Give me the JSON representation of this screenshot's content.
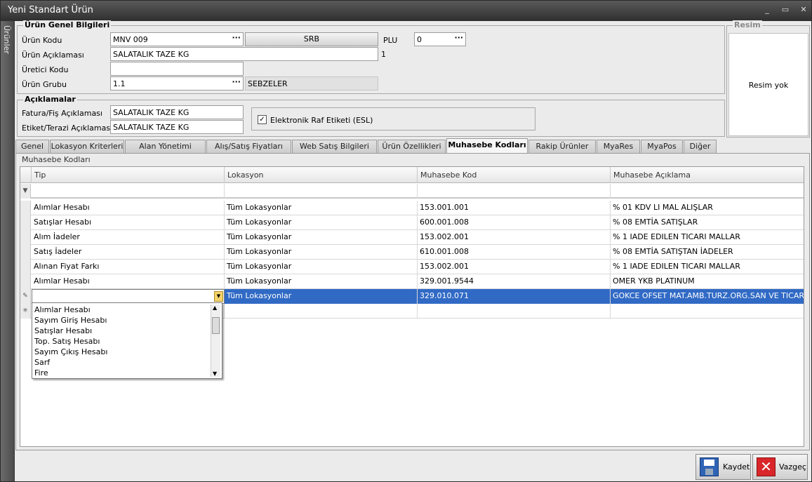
{
  "window": {
    "title": "Yeni Standart Ürün",
    "min": "_",
    "max": "▭",
    "close": "✕"
  },
  "sidebar": {
    "label": "Ürünler"
  },
  "general": {
    "title": "Ürün Genel Bilgileri",
    "kod_label": "Ürün Kodu",
    "kod_value": "MNV 009",
    "srb_button": "SRB",
    "plu_label": "PLU",
    "plu_value": "0",
    "aciklama_label": "Ürün Açıklaması",
    "aciklama_value": "SALATALIK TAZE KG",
    "aciklama_count": "1",
    "uretici_label": "Üretici Kodu",
    "uretici_value": "",
    "grup_label": "Ürün Grubu",
    "grup_value": "1.1",
    "grup_name": "SEBZELER",
    "dots": "···"
  },
  "image": {
    "title": "Resim",
    "placeholder": "Resim yok"
  },
  "descriptions": {
    "title": "Açıklamalar",
    "fatura_label": "Fatura/Fiş Açıklaması",
    "fatura_value": "SALATALIK TAZE KG",
    "etiket_label": "Etiket/Terazi Açıklaması",
    "etiket_value": "SALATALIK TAZE KG",
    "esl_label": "Elektronik Raf Etiketi (ESL)",
    "esl_checked": "✓"
  },
  "tabs": [
    "Genel",
    "Lokasyon Kriterleri",
    "Alan Yönetimi",
    "Alış/Satış Fiyatları",
    "Web Satış Bilgileri",
    "Ürün Özellikleri",
    "Muhasebe Kodları",
    "Rakip Ürünler",
    "MyaRes",
    "MyaPos",
    "Diğer"
  ],
  "panel": {
    "title": "Muhasebe Kodları"
  },
  "grid": {
    "columns": [
      "Tip",
      "Lokasyon",
      "Muhasebe Kod",
      "Muhasebe Açıklama"
    ],
    "rows": [
      [
        "Alımlar Hesabı",
        "Tüm Lokasyonlar",
        "153.001.001",
        "% 01 KDV LI MAL ALIŞLAR"
      ],
      [
        "Satışlar Hesabı",
        "Tüm Lokasyonlar",
        "600.001.008",
        "% 08 EMTİA SATIŞLAR"
      ],
      [
        "Alım İadeler",
        "Tüm Lokasyonlar",
        "153.002.001",
        "% 1 IADE EDILEN TICARI MALLAR"
      ],
      [
        "Satış İadeler",
        "Tüm Lokasyonlar",
        "610.001.008",
        "% 08 EMTİA SATIŞTAN İADELER"
      ],
      [
        "Alınan Fiyat Farkı",
        "Tüm Lokasyonlar",
        "153.002.001",
        "% 1 IADE EDILEN TICARI MALLAR"
      ],
      [
        "Alımlar Hesabı",
        "Tüm Lokasyonlar",
        "329.001.9544",
        "OMER YKB PLATINUM"
      ],
      [
        "",
        "Tüm Lokasyonlar",
        "329.010.071",
        "GOKCE OFSET MAT.AMB.TURZ.ORG.SAN VE TICARET..."
      ]
    ]
  },
  "dropdown": {
    "items": [
      "Alımlar Hesabı",
      "Sayım Giriş Hesabı",
      "Satışlar Hesabı",
      "Top. Satış Hesabı",
      "Sayım Çıkış Hesabı",
      "Sarf",
      "Fire"
    ]
  },
  "footer": {
    "save": "Kaydet",
    "cancel": "Vazgeç"
  }
}
